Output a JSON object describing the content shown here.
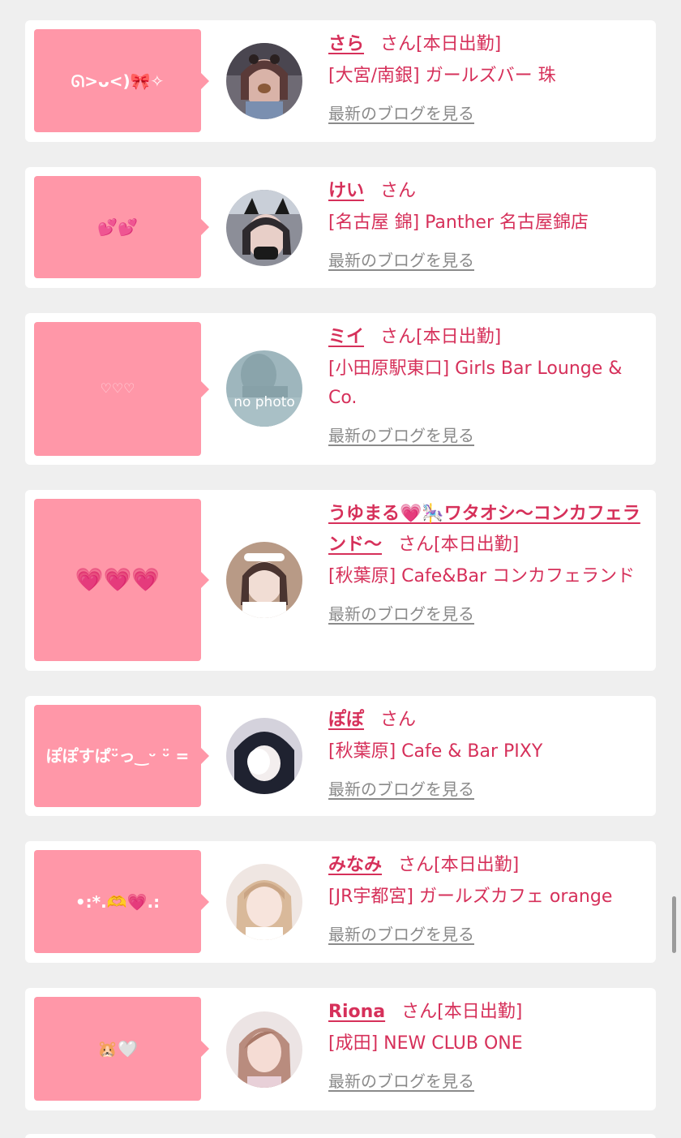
{
  "suffix": "さん",
  "blog_link_label": "最新のブログを見る",
  "colors": {
    "page_background": "#efefef",
    "card_background": "#ffffff",
    "bubble": "#ff97a8",
    "accent_text": "#d6305a",
    "link_gray": "#8a8a8a"
  },
  "entries": [
    {
      "bubble_text": "ᘏ>ᴗ<)🎀✧",
      "name": "さら",
      "status": "[本日出勤]",
      "shop": "[大宮/南銀] ガールズバー 珠",
      "avatar_icon": "photo-avatar"
    },
    {
      "bubble_text": "💕💕",
      "name": "けい",
      "status": "",
      "shop": "[名古屋 錦] Panther 名古屋錦店",
      "avatar_icon": "photo-avatar"
    },
    {
      "bubble_text": "♡♡♡",
      "name": "ミイ",
      "status": "[本日出勤]",
      "shop": "[小田原駅東口] Girls Bar Lounge & Co.",
      "avatar_icon": "no-photo-avatar",
      "avatar_caption": "no photo"
    },
    {
      "bubble_text": "💗💗💗",
      "name": "うゆまる💗🎠ワタオシ〜コンカフェランド〜",
      "status": "[本日出勤]",
      "shop": "[秋葉原] Cafe&Bar コンカフェランド",
      "avatar_icon": "photo-avatar"
    },
    {
      "bubble_text": "ぽぽすぱᵕ̈っ‿ᵕ ᵕ̈ =",
      "name": "ぽぽ",
      "status": "",
      "shop": "[秋葉原] Cafe & Bar PIXY",
      "avatar_icon": "photo-avatar"
    },
    {
      "bubble_text": "•:*.🫶💗.:",
      "name": "みなみ",
      "status": "[本日出勤]",
      "shop": "[JR宇都宮] ガールズカフェ orange",
      "avatar_icon": "photo-avatar"
    },
    {
      "bubble_text": "🐹🤍",
      "name": "Riona",
      "status": "[本日出勤]",
      "shop": "[成田] NEW CLUB ONE",
      "avatar_icon": "photo-avatar"
    }
  ]
}
